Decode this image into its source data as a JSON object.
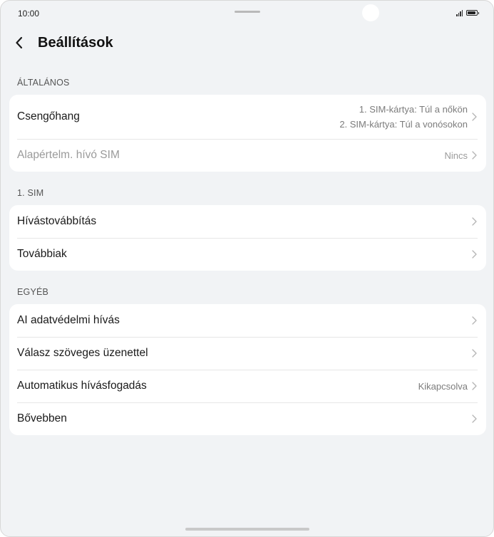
{
  "status_bar": {
    "time": "10:00"
  },
  "header": {
    "title": "Beállítások"
  },
  "sections": [
    {
      "title": "ÁLTALÁNOS",
      "items": [
        {
          "label": "Csengőhang",
          "value_line1": "1. SIM-kártya: Túl a nőkön",
          "value_line2": "2. SIM-kártya: Túl a vonósokon"
        },
        {
          "label": "Alapértelm. hívó SIM",
          "value": "Nincs"
        }
      ]
    },
    {
      "title": "1. SIM",
      "items": [
        {
          "label": "Hívástovábbítás"
        },
        {
          "label": "Továbbiak"
        }
      ]
    },
    {
      "title": "EGYÉB",
      "items": [
        {
          "label": "AI adatvédelmi hívás"
        },
        {
          "label": "Válasz szöveges üzenettel"
        },
        {
          "label": "Automatikus hívásfogadás",
          "value": "Kikapcsolva"
        },
        {
          "label": "Bővebben"
        }
      ]
    }
  ]
}
